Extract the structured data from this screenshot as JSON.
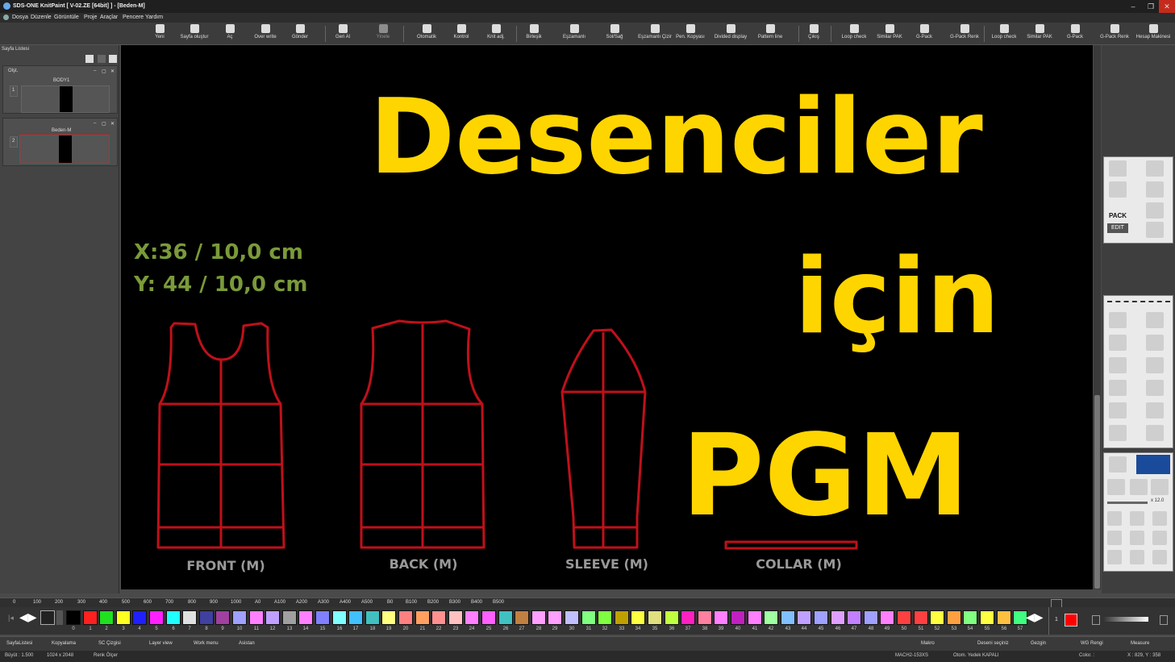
{
  "window": {
    "title": "SDS-ONE KnitPaint [ V-02.ZE [64bit] ] - [Beden-M]"
  },
  "menu": [
    "Dosya",
    "Düzenle",
    "Görüntüle",
    "Proje",
    "Araçlar",
    "Pencere",
    "Yardım"
  ],
  "toolbar": [
    {
      "label": "Yeni",
      "icon": "new-icon"
    },
    {
      "label": "Sayfa oluştur",
      "icon": "page-create-icon"
    },
    {
      "label": "Aç",
      "icon": "open-icon"
    },
    {
      "label": "Over write",
      "icon": "overwrite-icon"
    },
    {
      "label": "Gönder",
      "icon": "send-icon"
    },
    {
      "label": "Geri Al",
      "icon": "undo-icon"
    },
    {
      "label": "Yinele",
      "icon": "redo-icon"
    },
    {
      "label": "Otomatik",
      "icon": "auto-icon"
    },
    {
      "label": "Kontrol",
      "icon": "check-icon"
    },
    {
      "label": "Knit adj.",
      "icon": "knit-adj-icon"
    },
    {
      "label": "Birleşik",
      "icon": "combine-icon"
    },
    {
      "label": "Eşzamanlı",
      "icon": "simultaneous-icon"
    },
    {
      "label": "Sol/Sağ",
      "icon": "left-right-icon"
    },
    {
      "label": "Eşzamanlı Çizir",
      "icon": "sync-draw-icon"
    },
    {
      "label": "Pen. Kopyası",
      "icon": "window-copy-icon"
    },
    {
      "label": "Divided display",
      "icon": "divided-display-icon"
    },
    {
      "label": "Pattern line",
      "icon": "pattern-line-icon"
    },
    {
      "label": "Çıkış",
      "icon": "exit-icon"
    },
    {
      "label": "Loop check",
      "icon": "loop-check-icon"
    },
    {
      "label": "Similar PAK",
      "icon": "similar-pak-icon"
    },
    {
      "label": "G-Pack",
      "icon": "g-pack-icon"
    },
    {
      "label": "G-Pack Renk",
      "icon": "g-pack-color-icon"
    },
    {
      "label": "Loop check",
      "icon": "loop-check-icon"
    },
    {
      "label": "Similar PAK",
      "icon": "similar-pak-icon"
    },
    {
      "label": "G-Pack",
      "icon": "g-pack-icon"
    },
    {
      "label": "G-Pack Renk",
      "icon": "g-pack-color-icon"
    },
    {
      "label": "Hesap Makinesi",
      "icon": "calculator-icon"
    }
  ],
  "left_panel": {
    "title": "Sayfa Listesi",
    "group_label": "Olşt.",
    "pages": [
      {
        "index": "1",
        "name": "BODY1"
      },
      {
        "index": "2",
        "name": "Beden-M"
      }
    ]
  },
  "canvas": {
    "headline_1": "Desenciler",
    "headline_2": "için",
    "headline_3": "PGM",
    "coord_x": "X:36 / 10,0 cm",
    "coord_y": "Y: 44 / 10,0 cm",
    "pieces": [
      "FRONT (M)",
      "BACK (M)",
      "SLEEVE (M)",
      "COLLAR (M)"
    ],
    "outline_color": "#c0101a",
    "headline_color": "#ffd500"
  },
  "ruler": [
    "0",
    "100",
    "200",
    "300",
    "400",
    "500",
    "600",
    "700",
    "800",
    "900",
    "1000",
    "A0",
    "A100",
    "A200",
    "A300",
    "A400",
    "A500",
    "B0",
    "B100",
    "B200",
    "B300",
    "B400",
    "B500"
  ],
  "palette": {
    "swatches": [
      {
        "n": "0",
        "c": "#000000"
      },
      {
        "n": "1",
        "c": "#ff2020"
      },
      {
        "n": "2",
        "c": "#20e020"
      },
      {
        "n": "3",
        "c": "#ffff20"
      },
      {
        "n": "4",
        "c": "#2020ff"
      },
      {
        "n": "5",
        "c": "#ff20ff"
      },
      {
        "n": "6",
        "c": "#20ffff"
      },
      {
        "n": "7",
        "c": "#e0e0e0"
      },
      {
        "n": "8",
        "c": "#4040a0"
      },
      {
        "n": "9",
        "c": "#a040a0"
      },
      {
        "n": "10",
        "c": "#a0a0ff"
      },
      {
        "n": "11",
        "c": "#ff80ff"
      },
      {
        "n": "12",
        "c": "#c0a0ff"
      },
      {
        "n": "13",
        "c": "#a0a0a0"
      },
      {
        "n": "14",
        "c": "#ff80ff"
      },
      {
        "n": "15",
        "c": "#8080ff"
      },
      {
        "n": "16",
        "c": "#80ffff"
      },
      {
        "n": "17",
        "c": "#40c0ff"
      },
      {
        "n": "18",
        "c": "#40c0c0"
      },
      {
        "n": "19",
        "c": "#ffff80"
      },
      {
        "n": "20",
        "c": "#ff8080"
      },
      {
        "n": "21",
        "c": "#ffa060"
      },
      {
        "n": "22",
        "c": "#ff9090"
      },
      {
        "n": "23",
        "c": "#ffc0c0"
      },
      {
        "n": "24",
        "c": "#ff80ff"
      },
      {
        "n": "25",
        "c": "#ff60ff"
      },
      {
        "n": "26",
        "c": "#40c0c0"
      },
      {
        "n": "27",
        "c": "#c08040"
      },
      {
        "n": "28",
        "c": "#ffa0ff"
      },
      {
        "n": "29",
        "c": "#ffa0ff"
      },
      {
        "n": "30",
        "c": "#c0c0ff"
      },
      {
        "n": "31",
        "c": "#80ff80"
      },
      {
        "n": "32",
        "c": "#80ff40"
      },
      {
        "n": "33",
        "c": "#c0a000"
      },
      {
        "n": "34",
        "c": "#ffff40"
      },
      {
        "n": "35",
        "c": "#e0e080"
      },
      {
        "n": "36",
        "c": "#c0ff40"
      },
      {
        "n": "37",
        "c": "#ff20c0"
      },
      {
        "n": "38",
        "c": "#ff80a0"
      },
      {
        "n": "39",
        "c": "#ff80ff"
      },
      {
        "n": "40",
        "c": "#c020c0"
      },
      {
        "n": "41",
        "c": "#ff80ff"
      },
      {
        "n": "42",
        "c": "#a0ffa0"
      },
      {
        "n": "43",
        "c": "#80c0ff"
      },
      {
        "n": "44",
        "c": "#c0a0ff"
      },
      {
        "n": "45",
        "c": "#a0a0ff"
      },
      {
        "n": "46",
        "c": "#e0a0ff"
      },
      {
        "n": "47",
        "c": "#c080ff"
      },
      {
        "n": "48",
        "c": "#a0a0ff"
      },
      {
        "n": "49",
        "c": "#ff80ff"
      },
      {
        "n": "50",
        "c": "#ff4040"
      },
      {
        "n": "51",
        "c": "#ff4040"
      },
      {
        "n": "52",
        "c": "#ffff40"
      },
      {
        "n": "53",
        "c": "#ffa040"
      },
      {
        "n": "54",
        "c": "#80ff80"
      },
      {
        "n": "55",
        "c": "#ffff40"
      },
      {
        "n": "56",
        "c": "#ffc040"
      },
      {
        "n": "57",
        "c": "#40ff80"
      }
    ],
    "active_color": "#ff0000",
    "index_value": "1"
  },
  "bottom_tabs": [
    "SayfaListesi",
    "Kopyalama",
    "SC Çizgisi",
    "Layer view",
    "Work menu",
    "Asistan",
    "Makro",
    "Deseni seçiniz",
    "Gezgin",
    "WG Rengi",
    "Measure"
  ],
  "status": {
    "zoom": "Büyüt : 1.500",
    "size": "1024 x 2048",
    "color_picker": "Renk Ölçer",
    "machine": "MACH2-153XS",
    "backup": "Otom. Yedek KAPALI",
    "color": "Color. :",
    "cursor": "X : 829, Y : 358"
  },
  "right_panel": {
    "pack_label": "PACK",
    "edit_label": "EDIT",
    "zoom_label": "x 12.0"
  }
}
